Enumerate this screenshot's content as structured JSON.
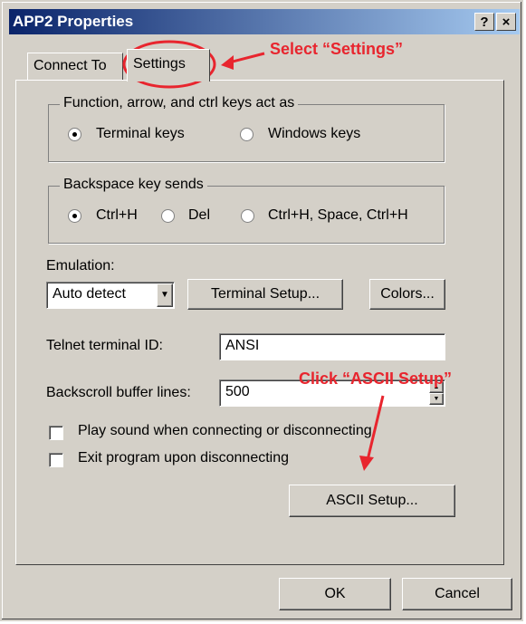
{
  "window": {
    "title": "APP2 Properties",
    "help_glyph": "?",
    "close_glyph": "×"
  },
  "tabs": [
    {
      "label": "Connect To"
    },
    {
      "label": "Settings"
    }
  ],
  "function_keys": {
    "legend": "Function, arrow, and ctrl keys act as",
    "options": [
      {
        "label": "Terminal keys",
        "selected": true
      },
      {
        "label": "Windows keys",
        "selected": false
      }
    ]
  },
  "backspace": {
    "legend": "Backspace key sends",
    "options": [
      {
        "label": "Ctrl+H",
        "selected": true
      },
      {
        "label": "Del",
        "selected": false
      },
      {
        "label": "Ctrl+H, Space, Ctrl+H",
        "selected": false
      }
    ]
  },
  "emulation": {
    "label": "Emulation:",
    "value": "Auto detect"
  },
  "buttons": {
    "terminal_setup": "Terminal Setup...",
    "colors": "Colors...",
    "ascii_setup": "ASCII Setup...",
    "ok": "OK",
    "cancel": "Cancel"
  },
  "telnet": {
    "label": "Telnet terminal ID:",
    "value": "ANSI"
  },
  "backscroll": {
    "label": "Backscroll buffer lines:",
    "value": "500"
  },
  "checkboxes": [
    {
      "label": "Play sound when connecting or disconnecting",
      "checked": false
    },
    {
      "label": "Exit program upon disconnecting",
      "checked": false
    }
  ],
  "annotations": {
    "select_settings": "Select  “Settings”",
    "click_ascii": "Click  “ASCII Setup”",
    "color": "#e8252e"
  }
}
